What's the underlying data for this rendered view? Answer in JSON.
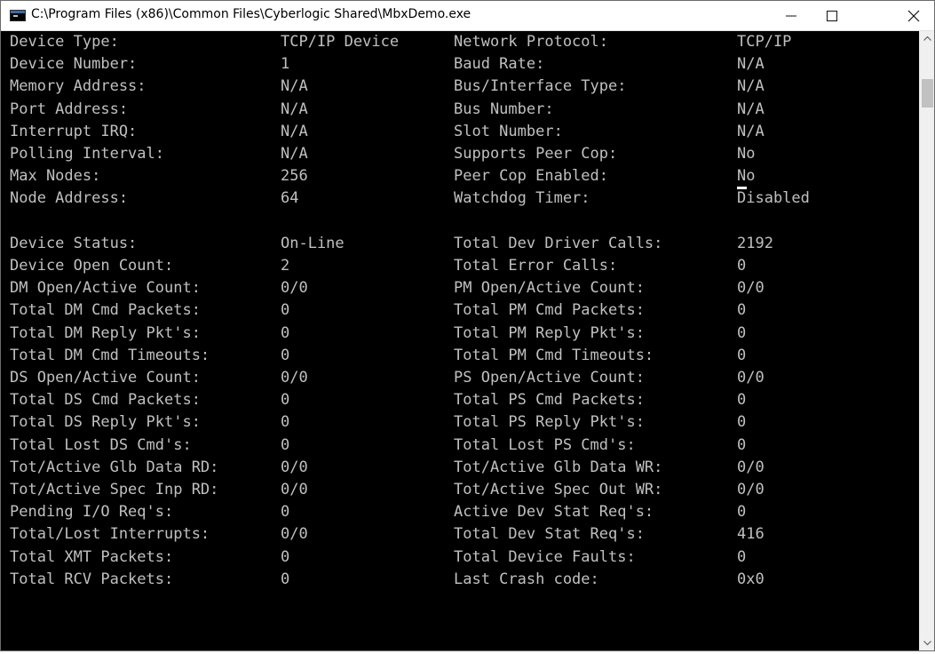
{
  "window": {
    "title": "C:\\Program Files (x86)\\Common Files\\Cyberlogic Shared\\MbxDemo.exe"
  },
  "icons": {
    "app": "console-app-icon",
    "minimize": "minimize-icon",
    "maximize": "maximize-icon",
    "close": "close-icon",
    "scroll_up": "chevron-up-icon",
    "scroll_down": "chevron-down-icon"
  },
  "rows": [
    {
      "l1": "Device Type:",
      "v1": "TCP/IP Device",
      "l2": "Network Protocol:",
      "v2": "TCP/IP"
    },
    {
      "l1": "Device Number:",
      "v1": "1",
      "l2": "Baud Rate:",
      "v2": "N/A"
    },
    {
      "l1": "Memory Address:",
      "v1": "N/A",
      "l2": "Bus/Interface Type:",
      "v2": "N/A"
    },
    {
      "l1": "Port Address:",
      "v1": "N/A",
      "l2": "Bus Number:",
      "v2": "N/A"
    },
    {
      "l1": "Interrupt IRQ:",
      "v1": "N/A",
      "l2": "Slot Number:",
      "v2": "N/A"
    },
    {
      "l1": "Polling Interval:",
      "v1": "N/A",
      "l2": "Supports Peer Cop:",
      "v2": "No"
    },
    {
      "l1": "Max Nodes:",
      "v1": "256",
      "l2": "Peer Cop Enabled:",
      "v2": "No"
    },
    {
      "l1": "Node Address:",
      "v1": "64",
      "l2": "Watchdog Timer:",
      "v2": "Disabled"
    },
    {
      "l1": "",
      "v1": "",
      "l2": "",
      "v2": ""
    },
    {
      "l1": "Device Status:",
      "v1": "On-Line",
      "l2": "Total Dev Driver Calls:",
      "v2": "2192"
    },
    {
      "l1": "Device Open Count:",
      "v1": "2",
      "l2": "Total Error Calls:",
      "v2": "0"
    },
    {
      "l1": "DM Open/Active Count:",
      "v1": "0/0",
      "l2": "PM Open/Active Count:",
      "v2": "0/0"
    },
    {
      "l1": "Total DM Cmd Packets:",
      "v1": "0",
      "l2": "Total PM Cmd Packets:",
      "v2": "0"
    },
    {
      "l1": "Total DM Reply Pkt's:",
      "v1": "0",
      "l2": "Total PM Reply Pkt's:",
      "v2": "0"
    },
    {
      "l1": "Total DM Cmd Timeouts:",
      "v1": "0",
      "l2": "Total PM Cmd Timeouts:",
      "v2": "0"
    },
    {
      "l1": "DS Open/Active Count:",
      "v1": "0/0",
      "l2": "PS Open/Active Count:",
      "v2": "0/0"
    },
    {
      "l1": "Total DS Cmd Packets:",
      "v1": "0",
      "l2": "Total PS Cmd Packets:",
      "v2": "0"
    },
    {
      "l1": "Total DS Reply Pkt's:",
      "v1": "0",
      "l2": "Total PS Reply Pkt's:",
      "v2": "0"
    },
    {
      "l1": "Total Lost DS Cmd's:",
      "v1": "0",
      "l2": "Total Lost PS Cmd's:",
      "v2": "0"
    },
    {
      "l1": "Tot/Active Glb Data RD:",
      "v1": "0/0",
      "l2": "Tot/Active Glb Data WR:",
      "v2": "0/0"
    },
    {
      "l1": "Tot/Active Spec Inp RD:",
      "v1": "0/0",
      "l2": "Tot/Active Spec Out WR:",
      "v2": "0/0"
    },
    {
      "l1": "Pending I/O Req's:",
      "v1": "0",
      "l2": "Active Dev Stat Req's:",
      "v2": "0"
    },
    {
      "l1": "Total/Lost Interrupts:",
      "v1": "0/0",
      "l2": "Total Dev Stat Req's:",
      "v2": "416"
    },
    {
      "l1": "Total XMT Packets:",
      "v1": "0",
      "l2": "Total Device Faults:",
      "v2": "0"
    },
    {
      "l1": "Total RCV Packets:",
      "v1": "0",
      "l2": "Last Crash code:",
      "v2": "0x0"
    }
  ]
}
